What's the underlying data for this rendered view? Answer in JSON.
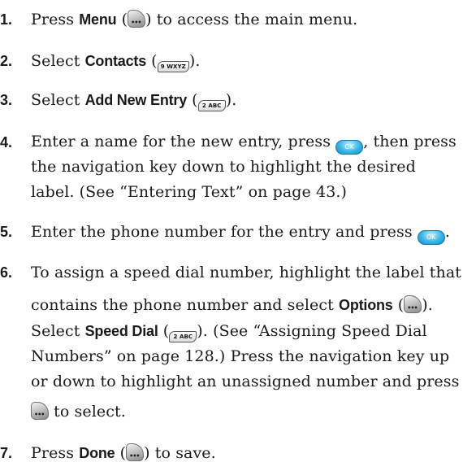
{
  "steps": [
    {
      "number": "1.",
      "lines": [
        {
          "t1": "Press ",
          "k1": "Menu",
          "t2": " (",
          "t3": ") to access the main menu."
        }
      ]
    },
    {
      "number": "2.",
      "lines": [
        {
          "t1": "Select ",
          "k1": "Contacts",
          "t2": " (",
          "key": "9 WXYZ",
          "t3": ")."
        }
      ]
    },
    {
      "number": "3.",
      "lines": [
        {
          "t1": "Select ",
          "k1": "Add New Entry",
          "t2": " (",
          "key": "2 ABC",
          "t3": ")."
        }
      ]
    },
    {
      "number": "4.",
      "lines": [
        {
          "t1": "Enter a name for the new entry, press ",
          "ok": "OK",
          "t2": ", then press"
        },
        {
          "t1": "the navigation key down to highlight the desired"
        },
        {
          "t1": "label. (See “Entering Text” on page 43.)"
        }
      ]
    },
    {
      "number": "5.",
      "lines": [
        {
          "t1": "Enter the phone number for the entry and press ",
          "ok": "OK",
          "t2": "."
        }
      ]
    },
    {
      "number": "6.",
      "lines": [
        {
          "t1": "To assign a speed dial number, highlight the label that"
        },
        {
          "t1": "contains the phone number and select ",
          "k1": "Options",
          "t2": " (",
          "t3": ")."
        },
        {
          "t1": "Select ",
          "k1": "Speed Dial",
          "t2": " (",
          "key": "2 ABC",
          "t3": "). (See “Assigning Speed Dial"
        },
        {
          "t1": "Numbers” on page 128.) Press the navigation key up"
        },
        {
          "t1": "or down to highlight an unassigned number and press"
        },
        {
          "t1": " to select."
        }
      ]
    },
    {
      "number": "7.",
      "lines": [
        {
          "t1": "Press ",
          "k1": "Done",
          "t2": " (",
          "t3": ") to save."
        }
      ]
    }
  ],
  "icons": {
    "softkey": "softkey-icon",
    "keypad": "keypad-key-icon",
    "ok": "ok-button-icon"
  },
  "colors": {
    "ok_button": "#39b6e8",
    "text": "#1a1a1a"
  }
}
